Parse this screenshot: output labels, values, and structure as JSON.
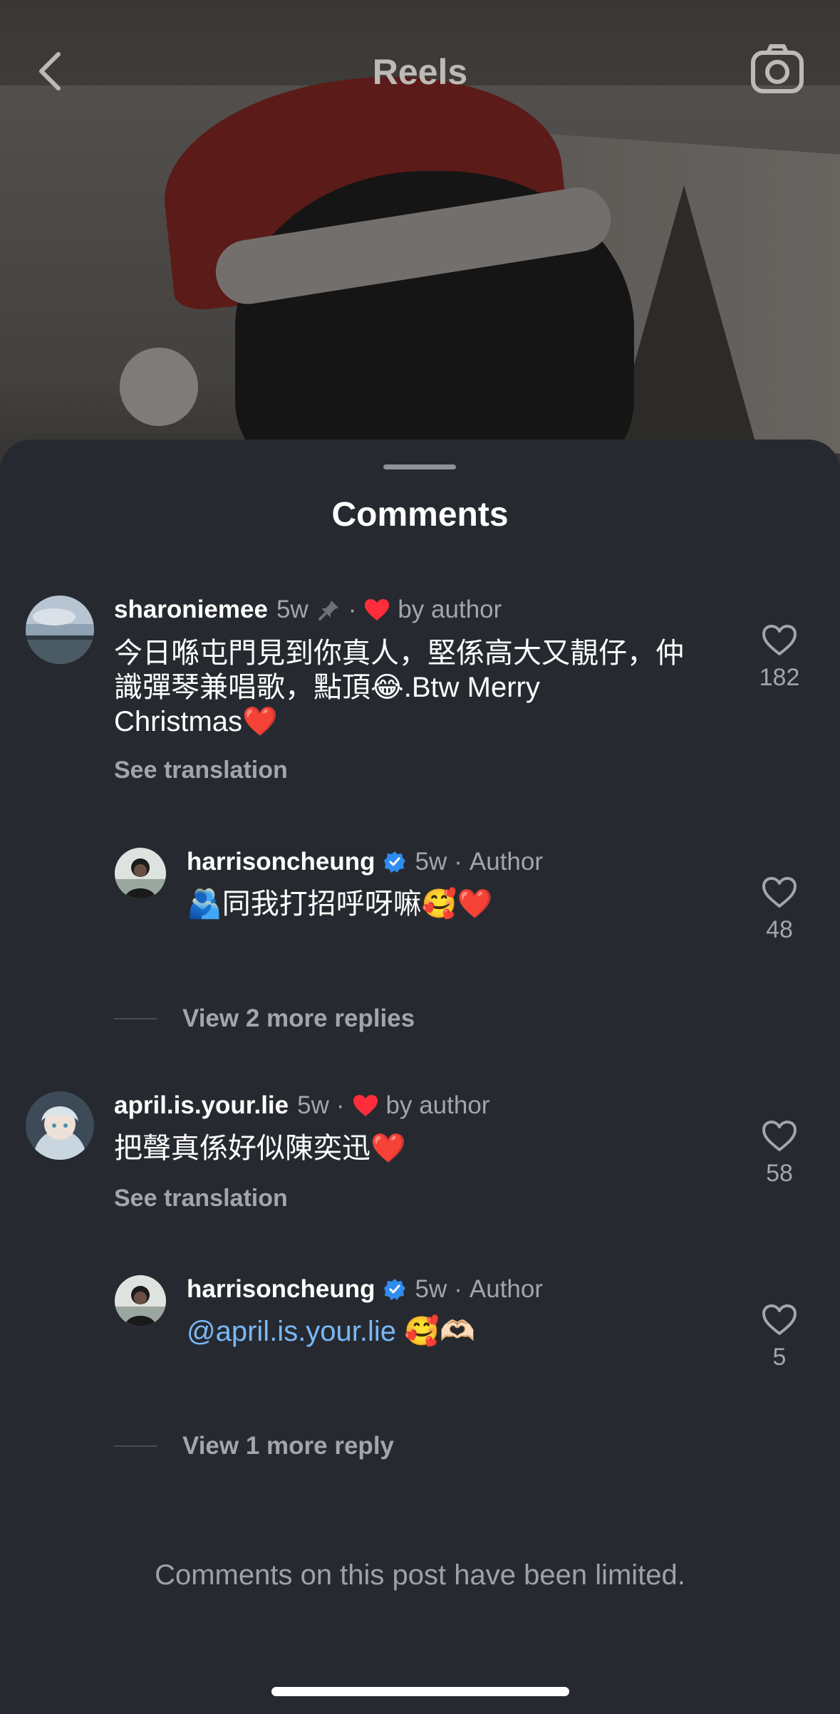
{
  "header": {
    "title": "Reels"
  },
  "sheet": {
    "title": "Comments"
  },
  "comments": [
    {
      "username": "sharoniemee",
      "time": "5w",
      "badge": "by author",
      "text_line1": "今日喺屯門見到你真人，堅係高大又靚仔，仲",
      "text_line2": "識彈琴兼唱歌，點頂😂.Btw Merry",
      "text_line3": "Christmas❤️",
      "see_translation": "See translation",
      "likes": "182"
    },
    {
      "username": "harrisoncheung",
      "time": "5w",
      "badge": "Author",
      "text": "🫂同我打招呼呀嘛🥰❤️",
      "likes": "48"
    },
    {
      "username": "april.is.your.lie",
      "time": "5w",
      "badge": "by author",
      "text": "把聲真係好似陳奕迅❤️",
      "see_translation": "See translation",
      "likes": "58"
    },
    {
      "username": "harrisoncheung",
      "time": "5w",
      "badge": "Author",
      "mention": "@april.is.your.lie",
      "text_after": " 🥰🫶🏻",
      "likes": "5"
    }
  ],
  "replies_links": [
    "View 2 more replies",
    "View 1 more reply"
  ],
  "footer": {
    "limited": "Comments on this post have been limited."
  },
  "colors": {
    "sheet_bg": "#262a30",
    "mention": "#79b8f6",
    "heart": "#ff2d3c",
    "verified": "#2f8cf0"
  }
}
